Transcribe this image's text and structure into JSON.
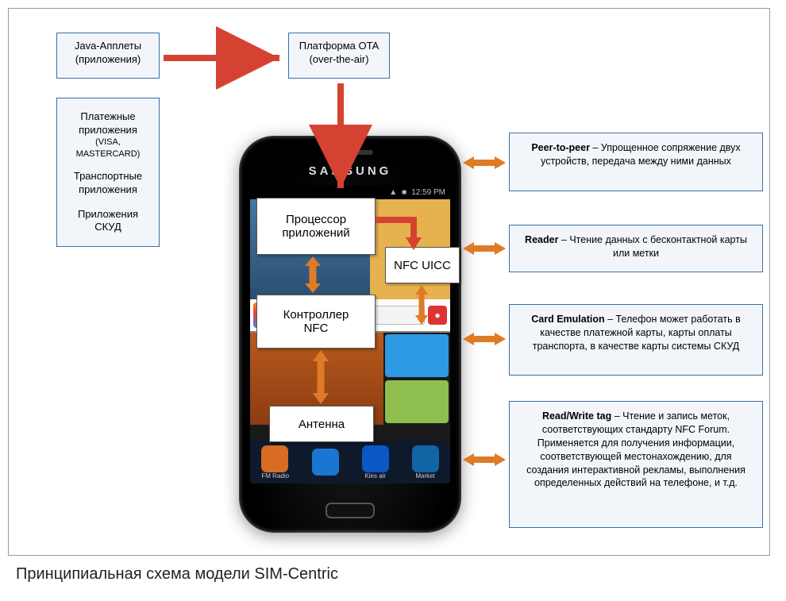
{
  "caption": "Принципиальная схема модели SIM-Centric",
  "left_boxes": {
    "java": {
      "line1": "Java-Апплеты",
      "line2": "(приложения)"
    },
    "apps": {
      "l1": "Платежные",
      "l2": "приложения",
      "l3": "(VISA, MASTERCARD)",
      "l4": "Транспортные",
      "l5": "приложения",
      "l6": "Приложения",
      "l7": "СКУД"
    }
  },
  "ota": {
    "line1": "Платформа OTA",
    "line2": "(over-the-air)"
  },
  "phone": {
    "brand": "SAMSUNG",
    "time": "12:59 PM",
    "labels": {
      "proc_l1": "Процессор",
      "proc_l2": "приложений",
      "nfc_uicc": "NFC UICC",
      "ctrl_l1": "Контроллер",
      "ctrl_l2": "NFC",
      "antenna": "Антенна"
    },
    "dock_tiles": [
      "FM Radio",
      "",
      "Kies air",
      "Market"
    ]
  },
  "right": {
    "p2p_title": "Peer-to-peer",
    "p2p_text": " – Упрощенное сопряжение двух устройств, передача между ними данных",
    "reader_title": "Reader",
    "reader_text": " – Чтение данных с бесконтактной карты или метки",
    "card_title": "Card Emulation",
    "card_text": " – Телефон может работать в качестве платежной карты, карты оплаты транспорта, в качестве карты системы СКУД",
    "rw_title": "Read/Write tag",
    "rw_text": " – Чтение и запись меток, соответствующих стандарту NFC Forum. Применяется для получения информации, соответствующей местонахождению, для создания интерактивной рекламы, выполнения определенных действий на телефоне, и т.д."
  },
  "colors": {
    "accent_red": "#d64231",
    "accent_orange": "#df7a26"
  }
}
